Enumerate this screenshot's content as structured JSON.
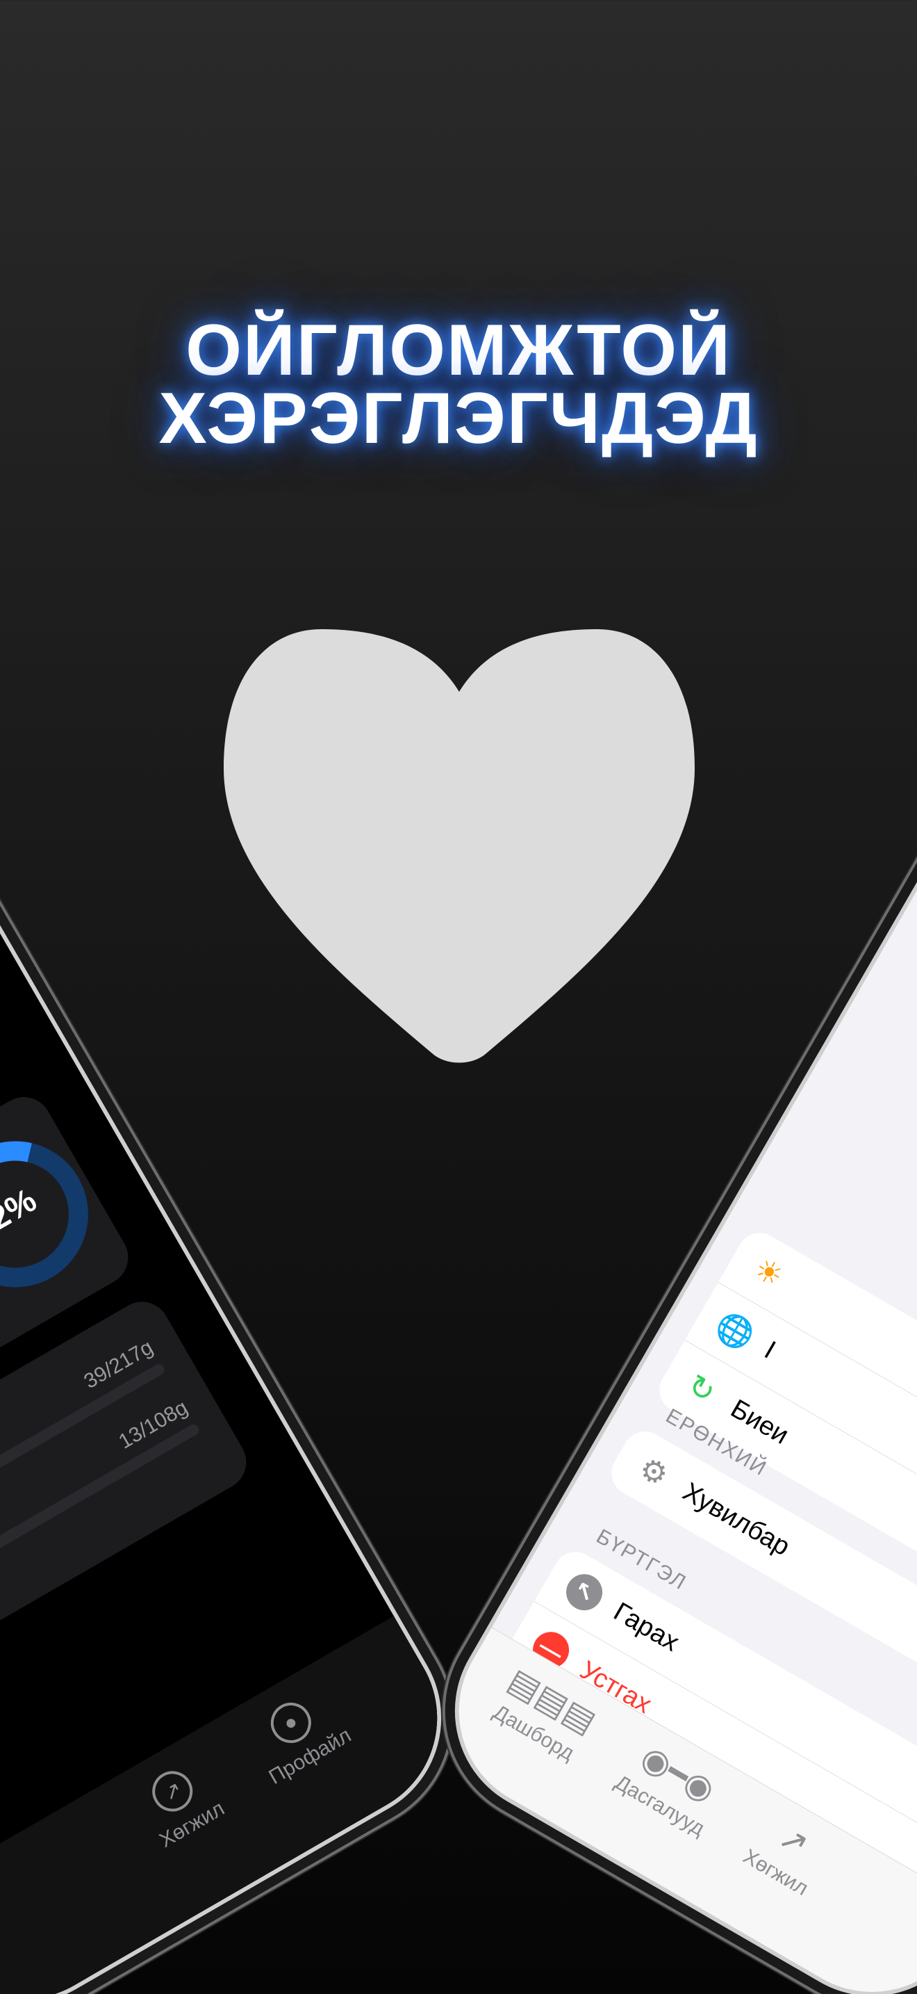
{
  "headline": {
    "line1": "ОЙГЛОМЖТОЙ",
    "line2": "ХЭРЭГЛЭГЧДЭД"
  },
  "heart_color": "#dcdcdc",
  "left_phone": {
    "progress_ring": {
      "label": "2%",
      "percent": 12
    },
    "macros": [
      {
        "value": "39/217g",
        "fraction": 0.18,
        "color": "#1f5db8"
      },
      {
        "value": "13/108g",
        "fraction": 0.12,
        "color": "#2e7d3a"
      }
    ],
    "tabs": [
      {
        "label": "Хөгжил",
        "icon": "arrow-up-right-circle-icon"
      },
      {
        "label": "Профайл",
        "icon": "person-circle-icon"
      }
    ]
  },
  "right_phone": {
    "group1_rows": [
      {
        "label": "",
        "icon": "sun-icon",
        "color": "#ff9f0a"
      },
      {
        "label": "I",
        "icon": "globe-icon",
        "color": "#0a84ff"
      },
      {
        "label": "Биеи",
        "icon": "sync-icon",
        "color": "#30d158"
      }
    ],
    "section_general": "ЕРӨНХИЙ",
    "general_rows": [
      {
        "label": "Хувилбар",
        "icon": "gear-icon",
        "color": "#8e8e93"
      }
    ],
    "section_account": "БҮРТГЭЛ",
    "account_rows": [
      {
        "label": "Гарах",
        "icon": "logout-icon",
        "color": "#8e8e93"
      },
      {
        "label": "Устгах",
        "icon": "delete-icon",
        "color": "#ff3b30"
      }
    ],
    "tabs": [
      {
        "label": "Дашборд",
        "icon": "chart-bars-icon"
      },
      {
        "label": "Дасгалууд",
        "icon": "dumbbell-icon"
      },
      {
        "label": "Хөгжил",
        "icon": "arrow-up-right-circle-icon"
      }
    ]
  }
}
